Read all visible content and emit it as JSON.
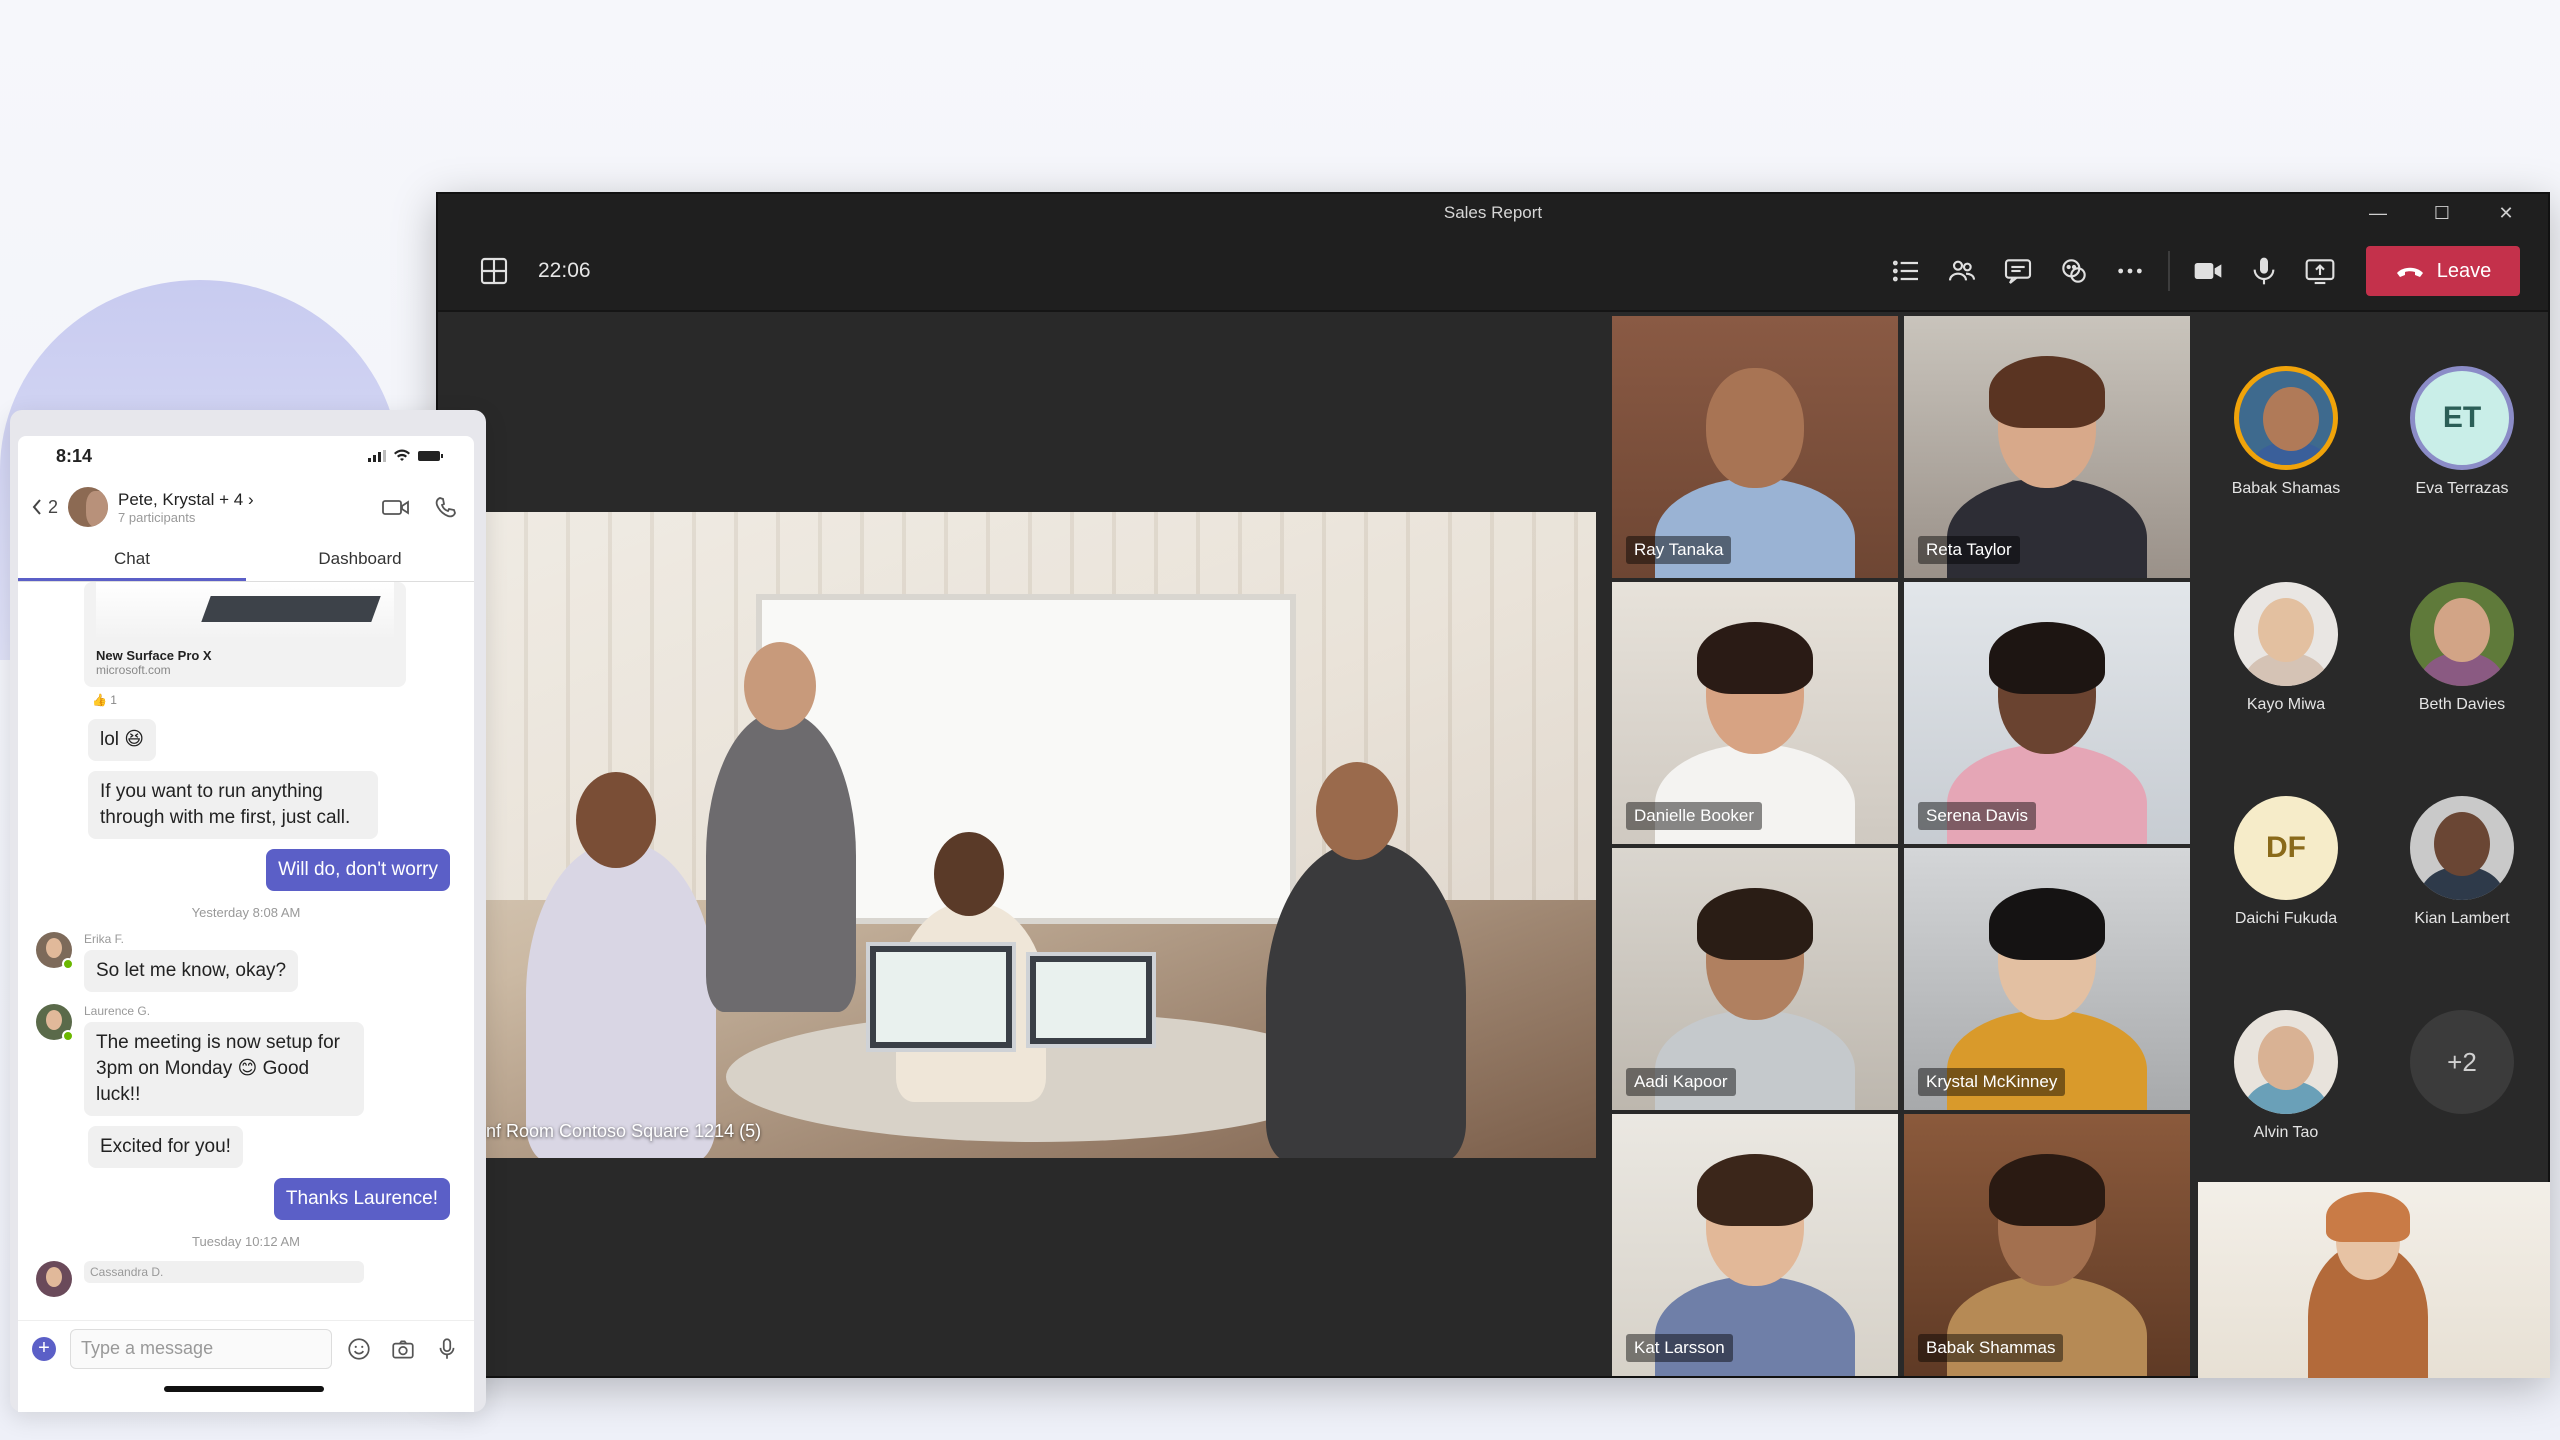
{
  "window": {
    "title": "Sales Report",
    "controls": {
      "minimize": "—",
      "maximize": "☐",
      "close": "✕"
    }
  },
  "toolbar": {
    "timer": "22:06",
    "leave_label": "Leave",
    "leave_color": "#c4314b",
    "icons": [
      "grid-icon",
      "list-icon",
      "people-icon",
      "chat-icon",
      "reactions-icon",
      "more-icon",
      "camera-icon",
      "mic-icon",
      "share-icon"
    ]
  },
  "main_video": {
    "caption": "nf Room Contoso Square 1214 (5)"
  },
  "video_tiles": [
    {
      "name": "Ray Tanaka"
    },
    {
      "name": "Reta Taylor"
    },
    {
      "name": "Danielle Booker"
    },
    {
      "name": "Serena Davis"
    },
    {
      "name": "Aadi Kapoor"
    },
    {
      "name": "Krystal McKinney"
    },
    {
      "name": "Kat Larsson"
    },
    {
      "name": "Babak Shammas"
    }
  ],
  "roster": [
    {
      "name": "Babak Shamas",
      "initials": "",
      "ring": "#f0a30a"
    },
    {
      "name": "Eva Terrazas",
      "initials": "ET",
      "ring": "#8b8cc7"
    },
    {
      "name": "Kayo Miwa",
      "initials": ""
    },
    {
      "name": "Beth Davies",
      "initials": ""
    },
    {
      "name": "Daichi Fukuda",
      "initials": "DF"
    },
    {
      "name": "Kian Lambert",
      "initials": ""
    },
    {
      "name": "Alvin Tao",
      "initials": ""
    },
    {
      "name": "",
      "initials": "+2"
    }
  ],
  "phone": {
    "time": "8:14",
    "back_count": "2",
    "chat_title": "Pete, Krystal + 4",
    "chat_subtitle": "7 participants",
    "tabs": [
      "Chat",
      "Dashboard"
    ],
    "link_card": {
      "title": "New Surface Pro X",
      "url": "microsoft.com",
      "reaction": "👍 1"
    },
    "messages": {
      "m1": "lol 😆",
      "m2": "If you want to run anything through with me first, just call.",
      "m3": "Will do, don't worry",
      "stamp1": "Yesterday 8:08 AM",
      "erika_name": "Erika F.",
      "m4": "So let me know, okay?",
      "laurence_name": "Laurence G.",
      "m5": "The meeting is now setup for 3pm on Monday 😊 Good luck!!",
      "m6": "Excited for you!",
      "m7": "Thanks Laurence!",
      "stamp2": "Tuesday 10:12 AM",
      "cassandra_name": "Cassandra D."
    },
    "composer_placeholder": "Type a message",
    "accent": "#5b5fc7"
  }
}
